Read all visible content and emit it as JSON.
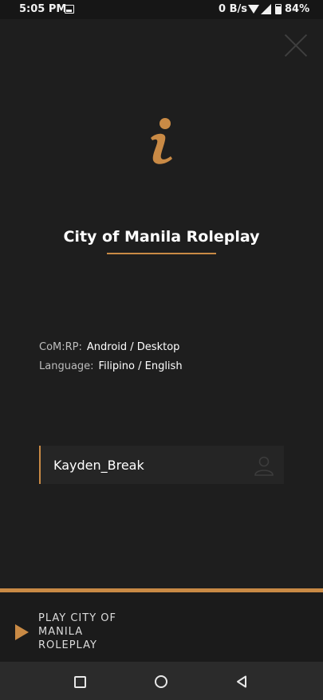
{
  "status_bar": {
    "time": "5:05 PM",
    "network_speed": "0 B/s",
    "battery_percent": "84%",
    "battery_level": 0.84,
    "icons": [
      "image-icon",
      "wifi-icon",
      "signal-icon",
      "battery-icon"
    ]
  },
  "dialog": {
    "close_icon": "close-icon",
    "info_icon": "info-icon",
    "title": "City of Manila Roleplay",
    "rows": [
      {
        "label": "CoM:RP:",
        "value": "Android / Desktop"
      },
      {
        "label": "Language:",
        "value": "Filipino / English"
      }
    ],
    "username": {
      "value": "Kayden_Break",
      "icon": "user-icon"
    }
  },
  "play": {
    "label": "PLAY CITY OF MANILA ROLEPLAY",
    "icon": "play-icon"
  },
  "nav": {
    "icons": [
      "recents-icon",
      "home-icon",
      "back-icon"
    ]
  },
  "colors": {
    "accent": "#c98a45",
    "background": "#1e1e1e",
    "field_background": "#252525",
    "navbar": "#2b2b2b"
  }
}
